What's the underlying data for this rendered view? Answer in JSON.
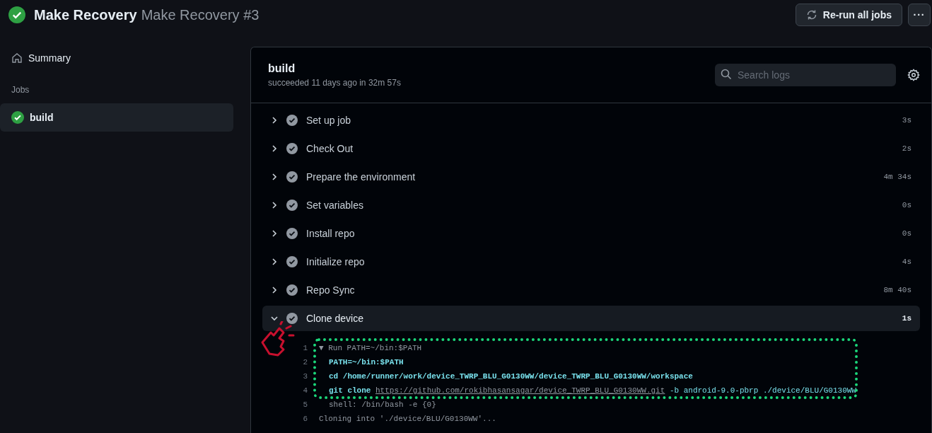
{
  "header": {
    "workflow": "Make Recovery",
    "run": "Make Recovery #3",
    "rerun_button": "Re-run all jobs",
    "more_button": "···"
  },
  "sidebar": {
    "summary": "Summary",
    "jobs_heading": "Jobs",
    "jobs": [
      {
        "name": "build",
        "selected": true
      }
    ]
  },
  "job": {
    "title": "build",
    "subtitle": "succeeded 11 days ago in 32m 57s",
    "search": {
      "placeholder": "Search logs"
    },
    "steps": [
      {
        "name": "Set up job",
        "duration": "3s",
        "expanded": false
      },
      {
        "name": "Check Out",
        "duration": "2s",
        "expanded": false
      },
      {
        "name": "Prepare the environment",
        "duration": "4m 34s",
        "expanded": false
      },
      {
        "name": "Set variables",
        "duration": "0s",
        "expanded": false
      },
      {
        "name": "Install repo",
        "duration": "0s",
        "expanded": false
      },
      {
        "name": "Initialize repo",
        "duration": "4s",
        "expanded": false
      },
      {
        "name": "Repo Sync",
        "duration": "8m 40s",
        "expanded": false
      },
      {
        "name": "Clone device",
        "duration": "1s",
        "expanded": true
      }
    ],
    "log_annotated": [
      {
        "number": "1",
        "indent": false,
        "parts": [
          {
            "kind": "muted",
            "text": "▼ Run PATH=~/bin:$PATH"
          }
        ]
      },
      {
        "number": "2",
        "indent": true,
        "parts": [
          {
            "kind": "command",
            "text": "PATH=~/bin:$PATH"
          }
        ]
      },
      {
        "number": "3",
        "indent": true,
        "parts": [
          {
            "kind": "command",
            "text": "cd /home/runner/work/device_TWRP_BLU_G0130WW/device_TWRP_BLU_G0130WW/workspace"
          }
        ]
      },
      {
        "number": "4",
        "indent": true,
        "parts": [
          {
            "kind": "command",
            "text": "git clone"
          },
          {
            "kind": "link",
            "text": "https://github.com/rokibhasansagar/device_TWRP_BLU_G0130WW.git"
          },
          {
            "kind": "argument",
            "text": "-b android-9.0-pbrp ./device/BLU/G0130WW"
          }
        ]
      }
    ],
    "log": [
      {
        "number": "5",
        "indent": true,
        "parts": [
          {
            "kind": "muted",
            "text": "shell: /bin/bash -e {0}"
          }
        ]
      },
      {
        "number": "6",
        "indent": false,
        "parts": [
          {
            "kind": "muted",
            "text": "Cloning into './device/BLU/G0130WW'..."
          }
        ]
      }
    ]
  }
}
